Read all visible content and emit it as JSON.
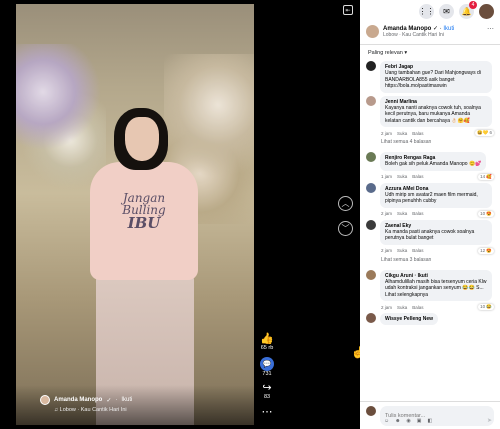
{
  "video": {
    "author": "Amanda Manopo",
    "follow_label": "Ikuti",
    "subtitle": "Lobow · Kau Cantik Hari Ini",
    "shirt_line1": "Jangan",
    "shirt_line2": "Bulling",
    "shirt_line3": "IBU",
    "actions": {
      "likes": "65 rb",
      "comments": "731",
      "shares": "83"
    }
  },
  "panel": {
    "post_author": "Amanda Manopo",
    "follow_label": "Ikuti",
    "post_subtitle": "Lobow · Kau Cantik Hari Ini",
    "filter_label": "Paling relevan",
    "notification_count": "4",
    "comments": [
      {
        "name": "Febri Jagap",
        "text": "Uang tambahan gue? Dari Mahjongways di BANDARBOLA855 asik banget https://bola.mo/pastimaxwin",
        "avatar_color": "#222222",
        "time": "",
        "reaction": "",
        "replies": ""
      },
      {
        "name": "Jenni Marlina",
        "text": "Kayanya nanti anaknya cowok tuh, soalnya kecil perutnya, baru mukanya Amanda kelatan cantik dan bercahaya 👌🏻🤗🥰",
        "avatar_color": "#b89a8c",
        "time": "2 jam",
        "reaction": "😆💛 6",
        "replies": "Lihat semua 4 balasan"
      },
      {
        "name": "Renjiro Rengas Raga",
        "text": "Boleh gak sih peluk Amanda Manopo 😊💕",
        "avatar_color": "#6a7a55",
        "time": "1 jam",
        "reaction": "14 🥰",
        "replies": ""
      },
      {
        "name": "Azzura AMei Dona",
        "text": "Udh mirip sm avatar2 maen film mermaid, pipinya penuhhh cubby",
        "avatar_color": "#5a6b8b",
        "time": "2 jam",
        "reaction": "10 😍",
        "replies": ""
      },
      {
        "name": "Zaenal Eky",
        "text": "Ka manda pasti anaknya cowok soalnya perutnya bulat banget",
        "avatar_color": "#3b3b3b",
        "time": "2 jam",
        "reaction": "12 😍",
        "replies": "Lihat semua 3 balasan"
      },
      {
        "name": "Cikgu Aruni · Ikuti",
        "text": "Alhamdulillah masih bisa tersenyum ceria Klw udah kontraksi jangankan senyum 😂😂 S... Lihat selengkapnya",
        "avatar_color": "#9b7a5a",
        "time": "2 jam",
        "reaction": "10 😂",
        "replies": ""
      },
      {
        "name": "Wissye Pelleng New",
        "text": "",
        "avatar_color": "#7a5a4a",
        "time": "",
        "reaction": "",
        "replies": ""
      }
    ],
    "comment_actions": {
      "like": "Suka",
      "reply": "Balas"
    },
    "composer_placeholder": "Tulis komentar..."
  }
}
